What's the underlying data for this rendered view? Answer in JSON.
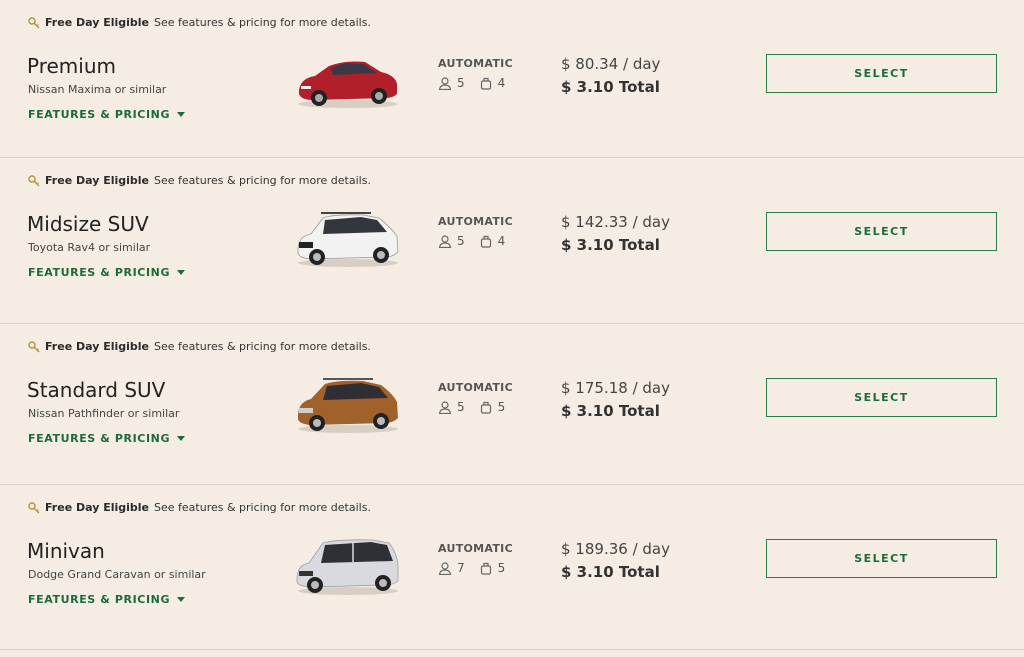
{
  "labels": {
    "eligible_bold": "Free Day Eligible",
    "eligible_rest": "See features & pricing for more details.",
    "features": "FEATURES & PRICING",
    "select": "SELECT",
    "transmission": "AUTOMATIC"
  },
  "colors": {
    "background": "#f5ede3",
    "accent_green": "#1d6a3a",
    "divider": "#d9d2c8"
  },
  "vehicles": [
    {
      "name": "Premium",
      "similar": "Nissan Maxima or similar",
      "passengers": "5",
      "bags": "4",
      "rate": "$ 80.34 / day",
      "total": "$ 3.10 Total",
      "car_color": "#b01f2a",
      "icon": "sedan-red"
    },
    {
      "name": "Midsize SUV",
      "similar": "Toyota Rav4 or similar",
      "passengers": "5",
      "bags": "4",
      "rate": "$ 142.33 / day",
      "total": "$ 3.10 Total",
      "car_color": "#f2f2f2",
      "icon": "suv-white"
    },
    {
      "name": "Standard SUV",
      "similar": "Nissan Pathfinder or similar",
      "passengers": "5",
      "bags": "5",
      "rate": "$ 175.18 / day",
      "total": "$ 3.10 Total",
      "car_color": "#a0622a",
      "icon": "suv-bronze"
    },
    {
      "name": "Minivan",
      "similar": "Dodge Grand Caravan or similar",
      "passengers": "7",
      "bags": "5",
      "rate": "$ 189.36 / day",
      "total": "$ 3.10 Total",
      "car_color": "#d8dade",
      "icon": "minivan-silver"
    }
  ]
}
